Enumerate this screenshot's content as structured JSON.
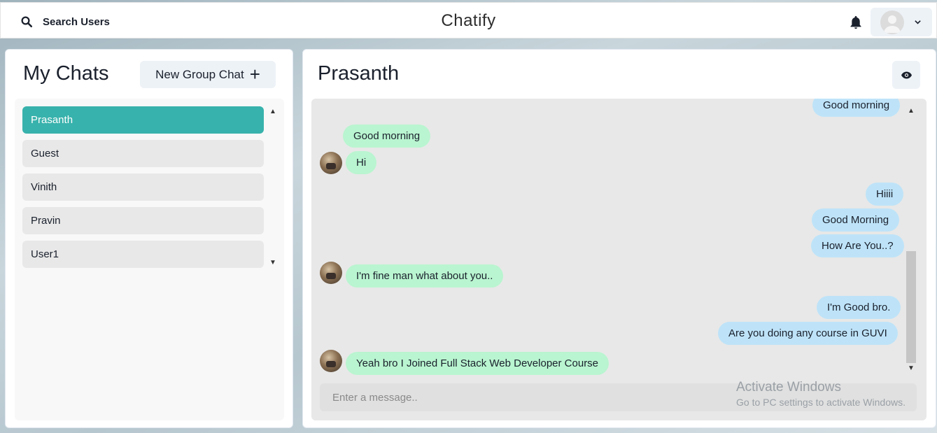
{
  "header": {
    "search_label": "Search Users",
    "app_title": "Chatify"
  },
  "sidebar": {
    "title": "My Chats",
    "new_group_label": "New Group Chat",
    "new_group_icon": "+",
    "chats": [
      {
        "name": "Prasanth",
        "active": true
      },
      {
        "name": "Guest",
        "active": false
      },
      {
        "name": "Vinith",
        "active": false
      },
      {
        "name": "Pravin",
        "active": false
      },
      {
        "name": "User1",
        "active": false
      }
    ]
  },
  "chat": {
    "title": "Prasanth",
    "messages": [
      {
        "text": "Good morning",
        "from": "me"
      },
      {
        "text": "Good morning",
        "from": "them"
      },
      {
        "text": "Hi",
        "from": "them"
      },
      {
        "text": "Hiiii",
        "from": "me"
      },
      {
        "text": "Good Morning",
        "from": "me"
      },
      {
        "text": "How Are You..?",
        "from": "me"
      },
      {
        "text": "I'm fine man what about you..",
        "from": "them"
      },
      {
        "text": "I'm Good bro.",
        "from": "me"
      },
      {
        "text": "Are you doing any course in GUVI",
        "from": "me"
      },
      {
        "text": "Yeah bro I Joined Full Stack Web Developer Course",
        "from": "them"
      }
    ],
    "input_placeholder": "Enter a message.."
  },
  "watermark": {
    "title": "Activate Windows",
    "subtitle": "Go to PC settings to activate Windows."
  },
  "colors": {
    "accent": "#38b2ac",
    "incoming_bubble": "#b9f5d0",
    "outgoing_bubble": "#bee3f8"
  }
}
